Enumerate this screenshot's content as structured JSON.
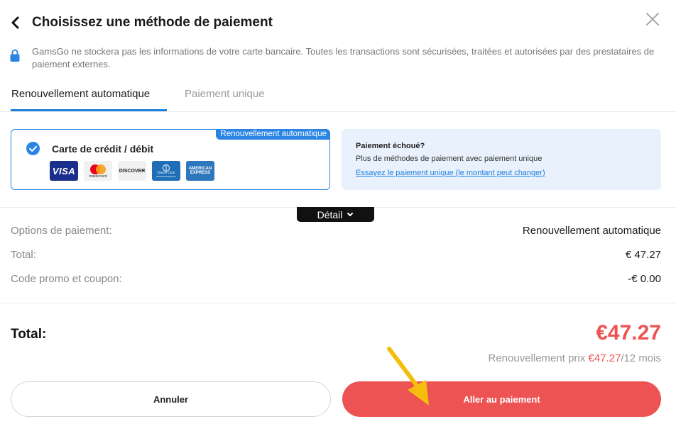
{
  "header": {
    "title": "Choisissez une méthode de paiement"
  },
  "notice": {
    "text": "GamsGo ne stockera pas les informations de votre carte bancaire. Toutes les transactions sont sécurisées, traitées et autorisées par des prestataires de paiement externes."
  },
  "tabs": [
    {
      "label": "Renouvellement automatique",
      "active": true
    },
    {
      "label": "Paiement unique",
      "active": false
    }
  ],
  "method_card": {
    "badge": "Renouvellement automatique",
    "label": "Carte de crédit / débit",
    "selected": true,
    "logos": {
      "visa": "VISA",
      "mastercard": "mastercard",
      "discover": "DISCOVER",
      "diners_top": "Diners Club",
      "diners_bottom": "INTERNATIONAL",
      "amex_top": "AMERICAN",
      "amex_bottom": "EXPRESS"
    }
  },
  "failed_box": {
    "title": "Paiement échoué?",
    "subtitle": "Plus de méthodes de paiement avec paiement unique",
    "link": "Essayez le paiement unique (le montant peut changer)"
  },
  "detail_toggle": {
    "label": "Détail"
  },
  "summary_rows": [
    {
      "label": "Options de paiement:",
      "value": "Renouvellement automatique"
    },
    {
      "label": "Total:",
      "value": "€ 47.27"
    },
    {
      "label": "Code promo et coupon:",
      "value": "-€ 0.00"
    }
  ],
  "total": {
    "label": "Total:",
    "value": "€47.27",
    "renew_prefix": "Renouvellement prix ",
    "renew_price": "€47.27",
    "renew_suffix": "/12 mois"
  },
  "buttons": {
    "cancel": "Annuler",
    "pay": "Aller au paiement"
  },
  "colors": {
    "accent_blue": "#2b84e4",
    "accent_red": "#ee5353",
    "arrow_yellow": "#f5bd0c"
  },
  "icons": {
    "back": "chevron-left-icon",
    "close": "close-icon",
    "lock": "lock-icon",
    "check": "check-circle-icon",
    "detail": "chevron-down-icon",
    "annotation": "arrow-annotation-icon"
  }
}
